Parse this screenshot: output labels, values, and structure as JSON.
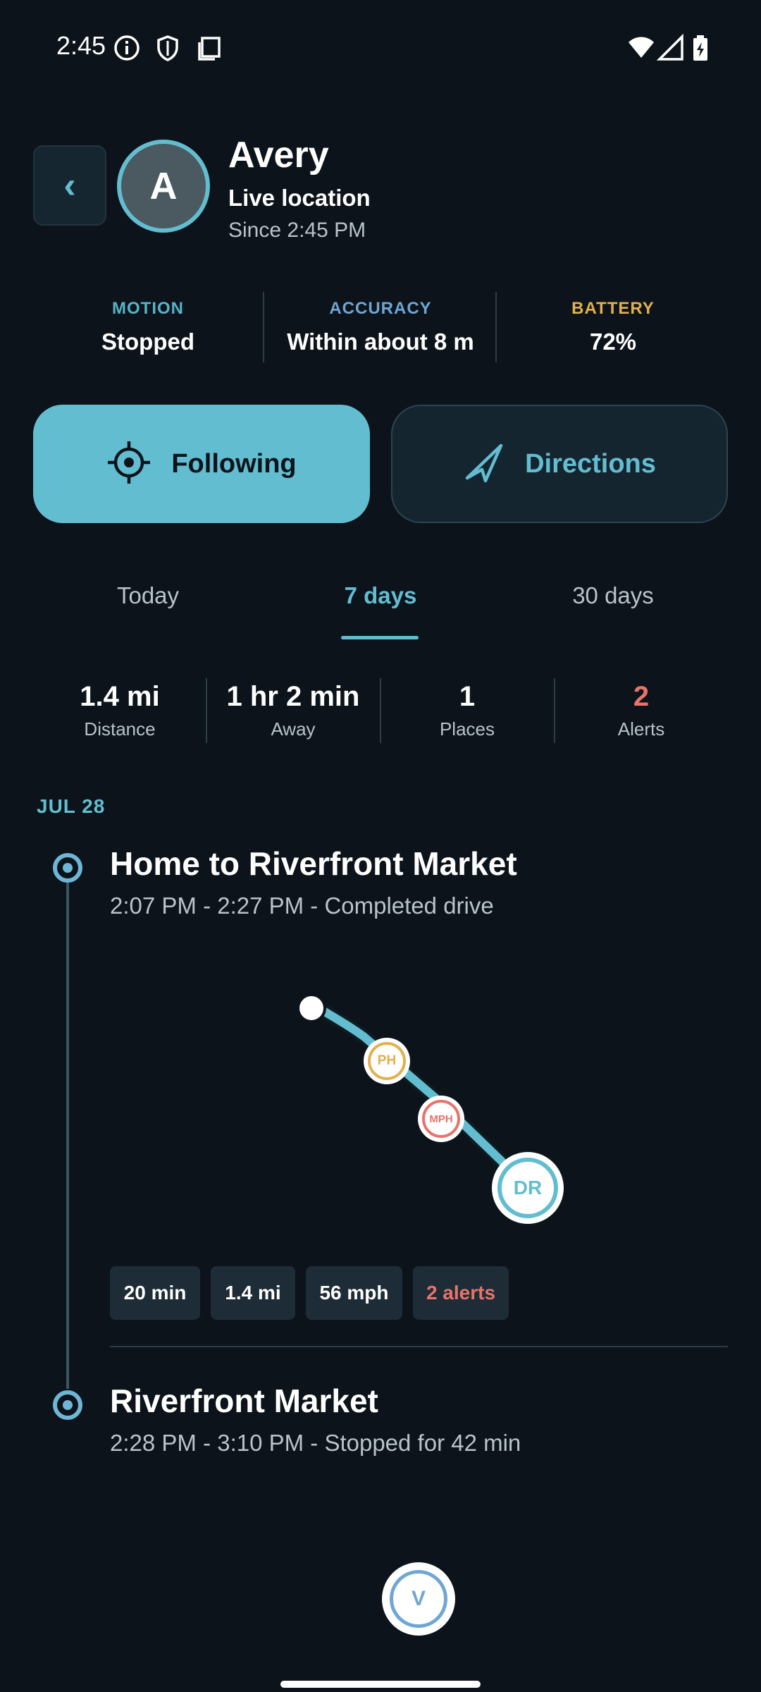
{
  "status_bar": {
    "time": "2:45",
    "icons": [
      "info-icon",
      "shield-icon",
      "screenshot-icon",
      "wifi-icon",
      "signal-icon",
      "battery-charging-icon"
    ]
  },
  "header": {
    "back_label": "‹",
    "avatar_initial": "A",
    "name": "Avery",
    "subtitle": "Live location",
    "since": "Since 2:45 PM"
  },
  "stats": [
    {
      "label": "MOTION",
      "value": "Stopped",
      "color": "#55b4c9"
    },
    {
      "label": "ACCURACY",
      "value": "Within about 8 m",
      "color": "#6fa6d6"
    },
    {
      "label": "BATTERY",
      "value": "72%",
      "color": "#e2b04e"
    }
  ],
  "actions": {
    "following_label": "Following",
    "directions_label": "Directions"
  },
  "tabs": [
    {
      "label": "Today",
      "active": false
    },
    {
      "label": "7 days",
      "active": true
    },
    {
      "label": "30 days",
      "active": false
    }
  ],
  "summary": [
    {
      "value": "1.4 mi",
      "label": "Distance"
    },
    {
      "value": "1 hr 2 min",
      "label": "Away"
    },
    {
      "value": "1",
      "label": "Places"
    },
    {
      "value": "2",
      "label": "Alerts",
      "color": "#e8736b"
    }
  ],
  "timeline": {
    "date": "JUL 28",
    "events": [
      {
        "title": "Home to Riverfront Market",
        "subtitle": "2:07 PM - 2:27 PM - Completed drive"
      },
      {
        "title": "Riverfront Market",
        "subtitle": "2:28 PM - 3:10 PM - Stopped for 42 min"
      }
    ],
    "route_markers": {
      "ph": "PH",
      "mph": "MPH",
      "dr": "DR"
    },
    "chips": [
      {
        "label": "20 min"
      },
      {
        "label": "1.4 mi"
      },
      {
        "label": "56 mph"
      },
      {
        "label": "2 alerts",
        "color": "#e8736b"
      }
    ]
  },
  "fab_label": "V",
  "colors": {
    "background": "#0c131a",
    "accent": "#63bdd0",
    "alert": "#e8736b",
    "warning": "#e2b04e"
  }
}
